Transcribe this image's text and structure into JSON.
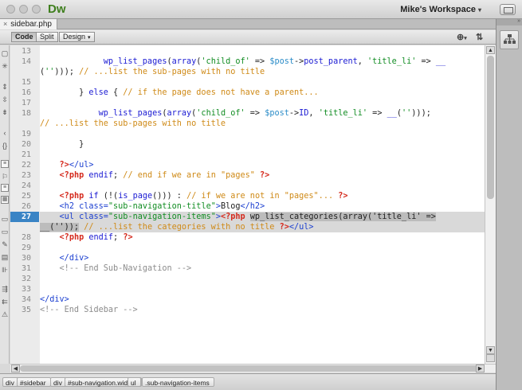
{
  "app": {
    "logo": "Dw",
    "workspace": "Mike's Workspace"
  },
  "document": {
    "tab_name": "sidebar.php",
    "close_glyph": "×"
  },
  "toolbar": {
    "code": "Code",
    "split": "Split",
    "design": "Design"
  },
  "gutter": {
    "current_line": "27",
    "lines": [
      {
        "n": "13",
        "row": 0
      },
      {
        "n": "14",
        "row": 1
      },
      {
        "n": "15",
        "row": 3
      },
      {
        "n": "16",
        "row": 4
      },
      {
        "n": "17",
        "row": 5
      },
      {
        "n": "18",
        "row": 6
      },
      {
        "n": "19",
        "row": 8
      },
      {
        "n": "20",
        "row": 9
      },
      {
        "n": "21",
        "row": 10
      },
      {
        "n": "22",
        "row": 11
      },
      {
        "n": "23",
        "row": 12
      },
      {
        "n": "24",
        "row": 13
      },
      {
        "n": "25",
        "row": 14
      },
      {
        "n": "26",
        "row": 15
      },
      {
        "n": "27",
        "row": 16
      },
      {
        "n": "28",
        "row": 18
      },
      {
        "n": "29",
        "row": 19
      },
      {
        "n": "30",
        "row": 20
      },
      {
        "n": "31",
        "row": 21
      },
      {
        "n": "32",
        "row": 22
      },
      {
        "n": "33",
        "row": 23
      },
      {
        "n": "34",
        "row": 24
      },
      {
        "n": "35",
        "row": 25
      }
    ]
  },
  "code_rows": [
    {
      "row": 0,
      "parts": []
    },
    {
      "row": 1,
      "parts": [
        [
          "plain",
          "             "
        ],
        [
          "fn",
          "wp_list_pages"
        ],
        [
          "plain",
          "("
        ],
        [
          "fn",
          "array"
        ],
        [
          "plain",
          "("
        ],
        [
          "str",
          "'child_of'"
        ],
        [
          "plain",
          " => "
        ],
        [
          "var",
          "$post"
        ],
        [
          "plain",
          "->"
        ],
        [
          "fn",
          "post_parent"
        ],
        [
          "plain",
          ", "
        ],
        [
          "str",
          "'title_li'"
        ],
        [
          "plain",
          " => "
        ],
        [
          "fn",
          "__"
        ]
      ]
    },
    {
      "row": 2,
      "parts": [
        [
          "plain",
          "("
        ],
        [
          "str",
          "''"
        ],
        [
          "plain",
          ")));"
        ],
        [
          "cm",
          " // ...list the sub-pages with no title"
        ]
      ]
    },
    {
      "row": 3,
      "parts": []
    },
    {
      "row": 4,
      "parts": [
        [
          "plain",
          "        } "
        ],
        [
          "fn",
          "else"
        ],
        [
          "plain",
          " { "
        ],
        [
          "cm",
          "// if the page does not have a parent..."
        ]
      ]
    },
    {
      "row": 5,
      "parts": []
    },
    {
      "row": 6,
      "parts": [
        [
          "plain",
          "            "
        ],
        [
          "fn",
          "wp_list_pages"
        ],
        [
          "plain",
          "("
        ],
        [
          "fn",
          "array"
        ],
        [
          "plain",
          "("
        ],
        [
          "str",
          "'child_of'"
        ],
        [
          "plain",
          " => "
        ],
        [
          "var",
          "$post"
        ],
        [
          "plain",
          "->"
        ],
        [
          "fn",
          "ID"
        ],
        [
          "plain",
          ", "
        ],
        [
          "str",
          "'title_li'"
        ],
        [
          "plain",
          " => "
        ],
        [
          "fn",
          "__"
        ],
        [
          "plain",
          "("
        ],
        [
          "str",
          "''"
        ],
        [
          "plain",
          ")));"
        ]
      ]
    },
    {
      "row": 7,
      "parts": [
        [
          "cm",
          "// ...list the sub-pages with no title"
        ]
      ]
    },
    {
      "row": 8,
      "parts": []
    },
    {
      "row": 9,
      "parts": [
        [
          "plain",
          "        }"
        ]
      ]
    },
    {
      "row": 10,
      "parts": []
    },
    {
      "row": 11,
      "parts": [
        [
          "plain",
          "    "
        ],
        [
          "kw",
          "?>"
        ],
        [
          "tag",
          "</ul>"
        ]
      ]
    },
    {
      "row": 12,
      "parts": [
        [
          "plain",
          "    "
        ],
        [
          "kw",
          "<?php"
        ],
        [
          "plain",
          " "
        ],
        [
          "fn",
          "endif"
        ],
        [
          "plain",
          ";"
        ],
        [
          "cm",
          " // end if we are in \"pages\" "
        ],
        [
          "kw",
          "?>"
        ]
      ]
    },
    {
      "row": 13,
      "parts": []
    },
    {
      "row": 14,
      "parts": [
        [
          "plain",
          "    "
        ],
        [
          "kw",
          "<?php"
        ],
        [
          "plain",
          " "
        ],
        [
          "fn",
          "if"
        ],
        [
          "plain",
          " (!("
        ],
        [
          "fn",
          "is_page"
        ],
        [
          "plain",
          "()))"
        ],
        [
          "plain",
          " : "
        ],
        [
          "cm",
          "// if we are not in \"pages\"... "
        ],
        [
          "kw",
          "?>"
        ]
      ]
    },
    {
      "row": 15,
      "parts": [
        [
          "plain",
          "    "
        ],
        [
          "tag",
          "<h2 "
        ],
        [
          "tag",
          "class="
        ],
        [
          "attrv",
          "\"sub-navigation-title\""
        ],
        [
          "tag",
          ">"
        ],
        [
          "plain",
          "Blog"
        ],
        [
          "tag",
          "</h2>"
        ]
      ]
    },
    {
      "row": 16,
      "hl": true,
      "parts": [
        [
          "plain",
          "    "
        ],
        [
          "tag",
          "<ul "
        ],
        [
          "tag",
          "class="
        ],
        [
          "attrv",
          "\"sub-navigation-items\""
        ],
        [
          "tag",
          ">"
        ],
        [
          "kw",
          "<?php"
        ],
        [
          "plain",
          " "
        ],
        [
          "sel",
          "wp_list_categories(array('title_li' =>"
        ]
      ]
    },
    {
      "row": 17,
      "hl": true,
      "parts": [
        [
          "sel",
          "__(''));"
        ],
        [
          "cm",
          " // ...list the categories with no title "
        ],
        [
          "kw",
          "?>"
        ],
        [
          "tag",
          "</ul>"
        ]
      ]
    },
    {
      "row": 18,
      "parts": [
        [
          "plain",
          "    "
        ],
        [
          "kw",
          "<?php"
        ],
        [
          "plain",
          " "
        ],
        [
          "fn",
          "endif"
        ],
        [
          "plain",
          "; "
        ],
        [
          "kw",
          "?>"
        ]
      ]
    },
    {
      "row": 19,
      "parts": []
    },
    {
      "row": 20,
      "parts": [
        [
          "plain",
          "    "
        ],
        [
          "tag",
          "</div>"
        ]
      ]
    },
    {
      "row": 21,
      "parts": [
        [
          "plain",
          "    "
        ],
        [
          "html-cm",
          "<!-- End Sub-Navigation -->"
        ]
      ]
    },
    {
      "row": 22,
      "parts": []
    },
    {
      "row": 23,
      "parts": []
    },
    {
      "row": 24,
      "parts": [
        [
          "tag",
          "</div>"
        ]
      ]
    },
    {
      "row": 25,
      "parts": [
        [
          "html-cm",
          "<!-- End Sidebar -->"
        ]
      ]
    }
  ],
  "tag_selector": [
    "div",
    "#sidebar",
    "div",
    "#sub-navigation.widget",
    "ul",
    ".sub-navigation-items"
  ],
  "icons": {
    "traffic_lights": [
      "close-icon",
      "minimize-icon",
      "zoom-icon"
    ],
    "toolbar": [
      "live-view-icon",
      "file-management-icon"
    ],
    "panels": "insert-panel-icon"
  }
}
